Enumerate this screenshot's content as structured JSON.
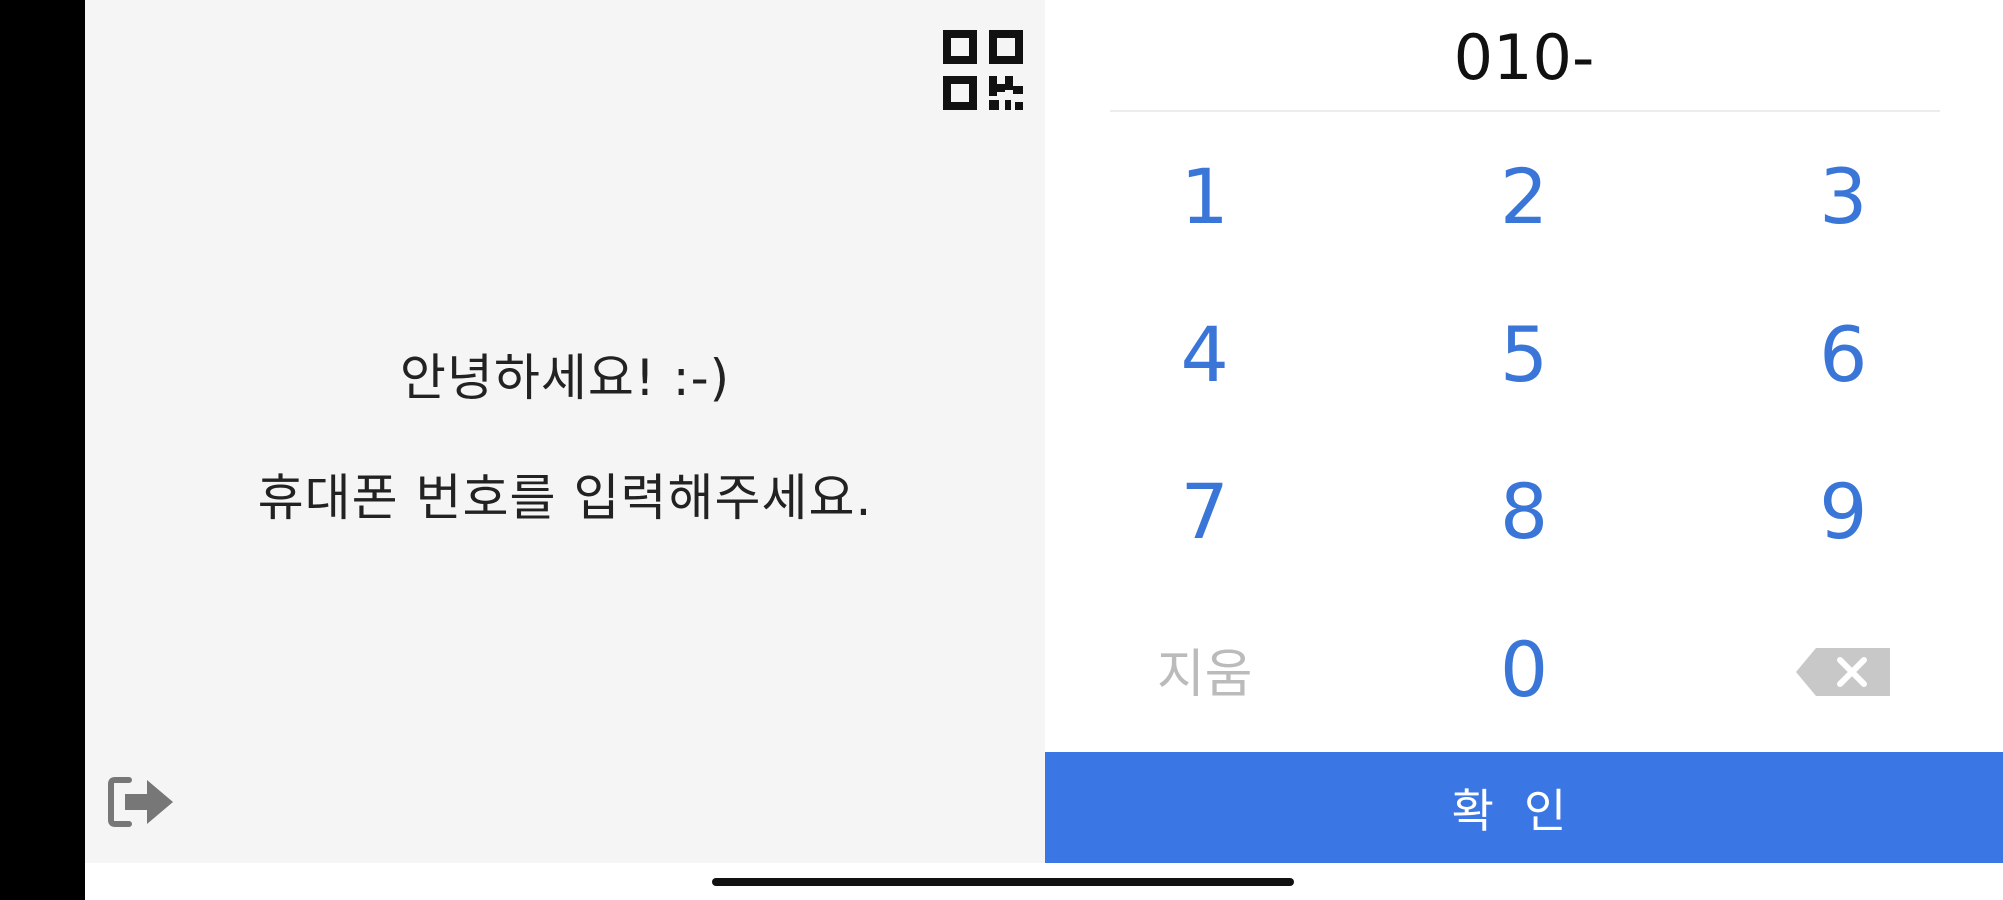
{
  "greeting": {
    "line1": "안녕하세요! :-)",
    "line2": "휴대폰 번호를 입력해주세요."
  },
  "phone": {
    "value": "010-"
  },
  "keypad": {
    "keys": [
      "1",
      "2",
      "3",
      "4",
      "5",
      "6",
      "7",
      "8",
      "9"
    ],
    "clear_label": "지움",
    "zero": "0"
  },
  "confirm": {
    "label": "확인"
  },
  "icons": {
    "qr": "qr-code-icon",
    "logout": "logout-icon",
    "backspace": "backspace-icon"
  },
  "colors": {
    "accent": "#3a76e4",
    "key_text": "#3a76d8",
    "left_bg": "#f5f5f5",
    "muted": "#bbbbbb"
  }
}
